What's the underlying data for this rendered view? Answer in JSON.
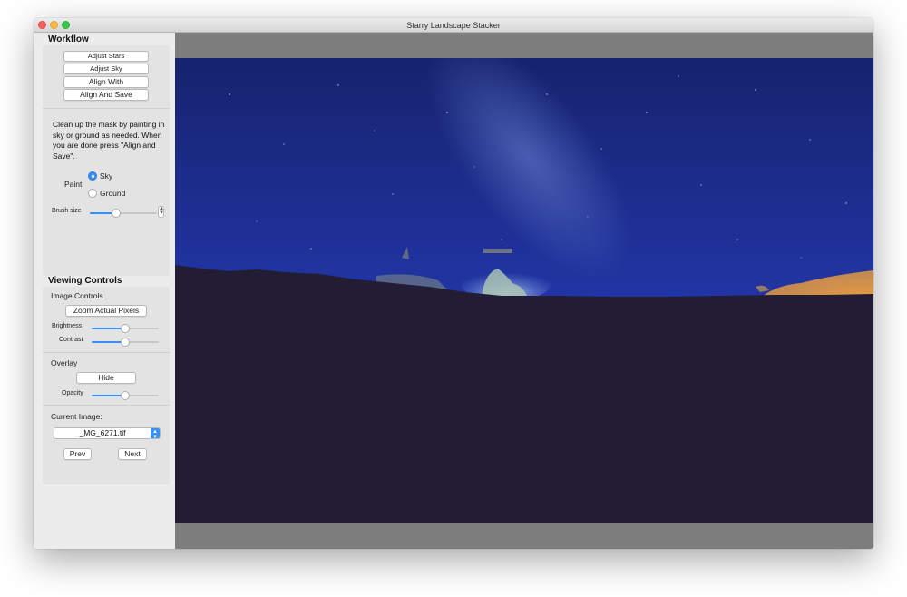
{
  "window": {
    "title": "Starry Landscape Stacker"
  },
  "workflow": {
    "heading": "Workflow",
    "buttons": {
      "adjust_stars": "Adjust Stars",
      "adjust_sky": "Adjust Sky",
      "align_with": "Align With",
      "align_and_save": "Align And Save"
    },
    "instructions": "Clean up the mask by painting in sky or ground as needed. When you are done press \"Align and Save\".",
    "paint": {
      "label": "Paint",
      "options": [
        "Sky",
        "Ground"
      ],
      "selected": "Sky"
    },
    "brush_size": {
      "label": "Brush size",
      "value": 0.38
    }
  },
  "viewing": {
    "heading": "Viewing Controls",
    "image_controls": {
      "heading": "Image Controls",
      "zoom_button": "Zoom Actual Pixels",
      "brightness": {
        "label": "Brightness",
        "value": 0.5
      },
      "contrast": {
        "label": "Contrast",
        "value": 0.5
      }
    },
    "overlay": {
      "heading": "Overlay",
      "hide_button": "Hide",
      "opacity": {
        "label": "Opacity",
        "value": 0.5
      }
    },
    "current_image": {
      "label": "Current Image:",
      "value": "_MG_6271.tif",
      "prev": "Prev",
      "next": "Next"
    }
  },
  "colors": {
    "accent": "#3a8ff5",
    "sky_top": "#16236e",
    "sky_bottom": "#2e47c4",
    "ground": "#221d33",
    "glow": "#e79a3a"
  }
}
